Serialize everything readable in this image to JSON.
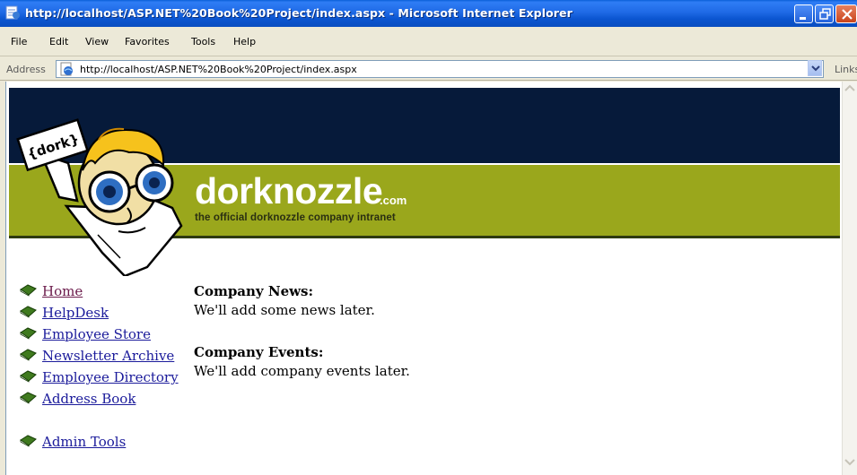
{
  "window": {
    "title": "http://localhost/ASP.NET%20Book%20Project/index.aspx - Microsoft Internet Explorer"
  },
  "menu": {
    "items": [
      "File",
      "Edit",
      "View",
      "Favorites",
      "Tools",
      "Help"
    ]
  },
  "address_bar": {
    "label": "Address",
    "url": "http://localhost/ASP.NET%20Book%20Project/index.aspx",
    "links_label": "Links"
  },
  "site": {
    "logo_sign": "{dork}",
    "name": "dorknozzle",
    "suffix": ".com",
    "tagline": "the official dorknozzle company intranet",
    "colors": {
      "navy": "#061a3a",
      "olive": "#9aa71c"
    }
  },
  "nav": {
    "items": [
      {
        "label": "Home",
        "icon": "book-icon",
        "visited": true
      },
      {
        "label": "HelpDesk",
        "icon": "book-icon"
      },
      {
        "label": "Employee Store",
        "icon": "book-icon"
      },
      {
        "label": "Newsletter Archive",
        "icon": "book-icon"
      },
      {
        "label": "Employee Directory",
        "icon": "book-icon"
      },
      {
        "label": "Address Book",
        "icon": "book-icon"
      },
      {
        "label": "Admin Tools",
        "icon": "book-icon"
      }
    ]
  },
  "content": {
    "news_heading": "Company News:",
    "news_text": "We'll add some news later.",
    "events_heading": "Company Events:",
    "events_text": "We'll add company events later."
  }
}
